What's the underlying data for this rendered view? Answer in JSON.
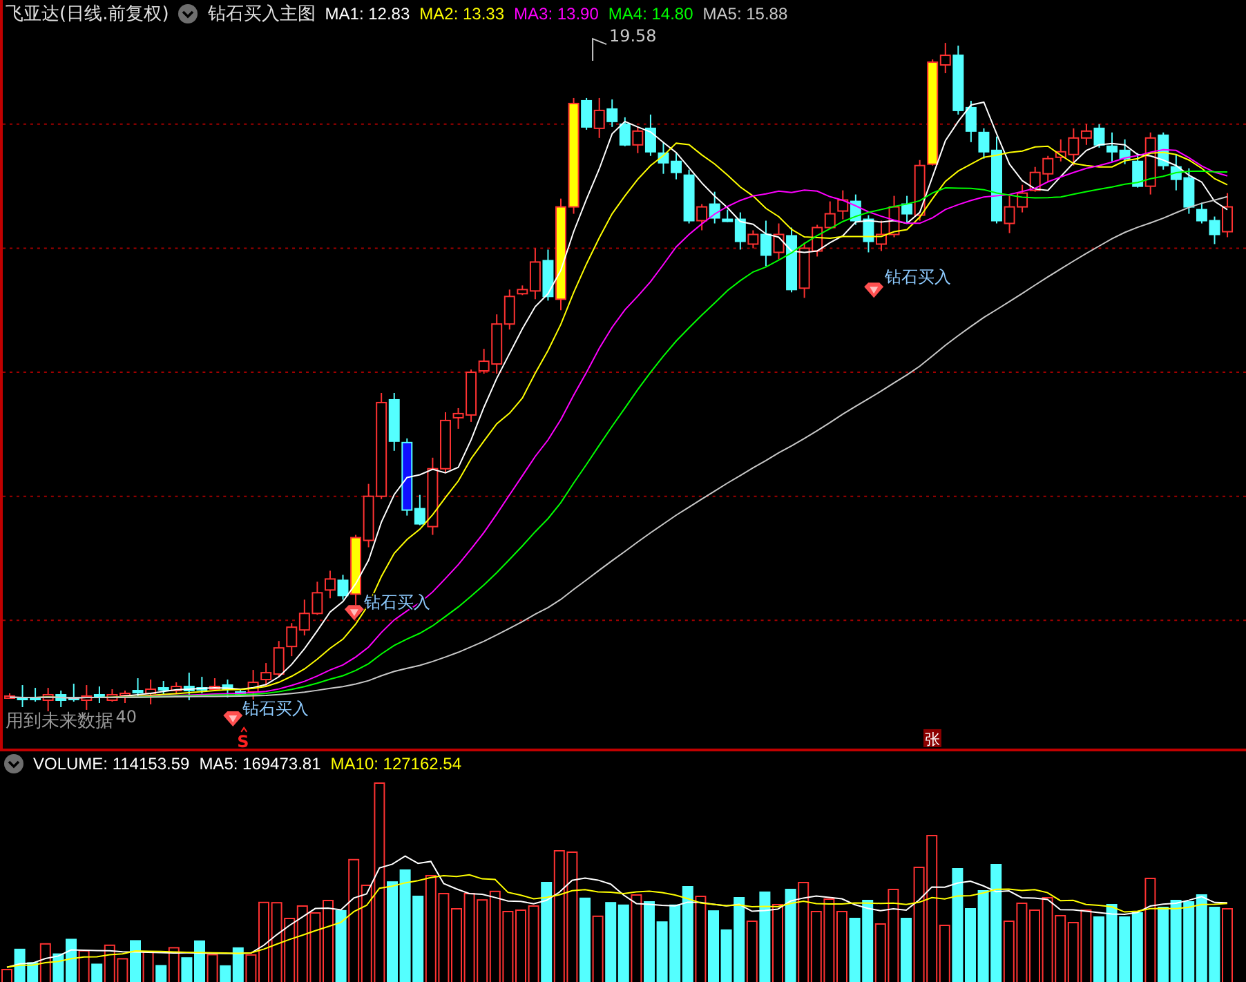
{
  "header": {
    "title": "飞亚达(日线.前复权)",
    "indicator": "钻石买入主图",
    "moving_averages": [
      {
        "label": "MA1:",
        "value": "12.83",
        "color": "#ffffff"
      },
      {
        "label": "MA2:",
        "value": "13.33",
        "color": "#ffff00"
      },
      {
        "label": "MA3:",
        "value": "13.90",
        "color": "#ff00ff"
      },
      {
        "label": "MA4:",
        "value": "14.80",
        "color": "#00ff00"
      },
      {
        "label": "MA5:",
        "value": "15.88",
        "color": "#c8c8c8"
      }
    ]
  },
  "chart_annotations": {
    "high_label": "19.58",
    "signals": [
      {
        "label": "钻石买入"
      },
      {
        "label": "钻石买入"
      },
      {
        "label": "钻石买入"
      }
    ],
    "warning": "用到未来数据",
    "warning_number": "40",
    "sell_mark": "S",
    "limit_badge": "张"
  },
  "volume_panel": {
    "label": "VOLUME:",
    "value": "114153.59",
    "indicators": [
      {
        "label": "MA5:",
        "value": "169473.81",
        "color": "#ffffff"
      },
      {
        "label": "MA10:",
        "value": "127162.54",
        "color": "#ffff00"
      }
    ]
  }
}
